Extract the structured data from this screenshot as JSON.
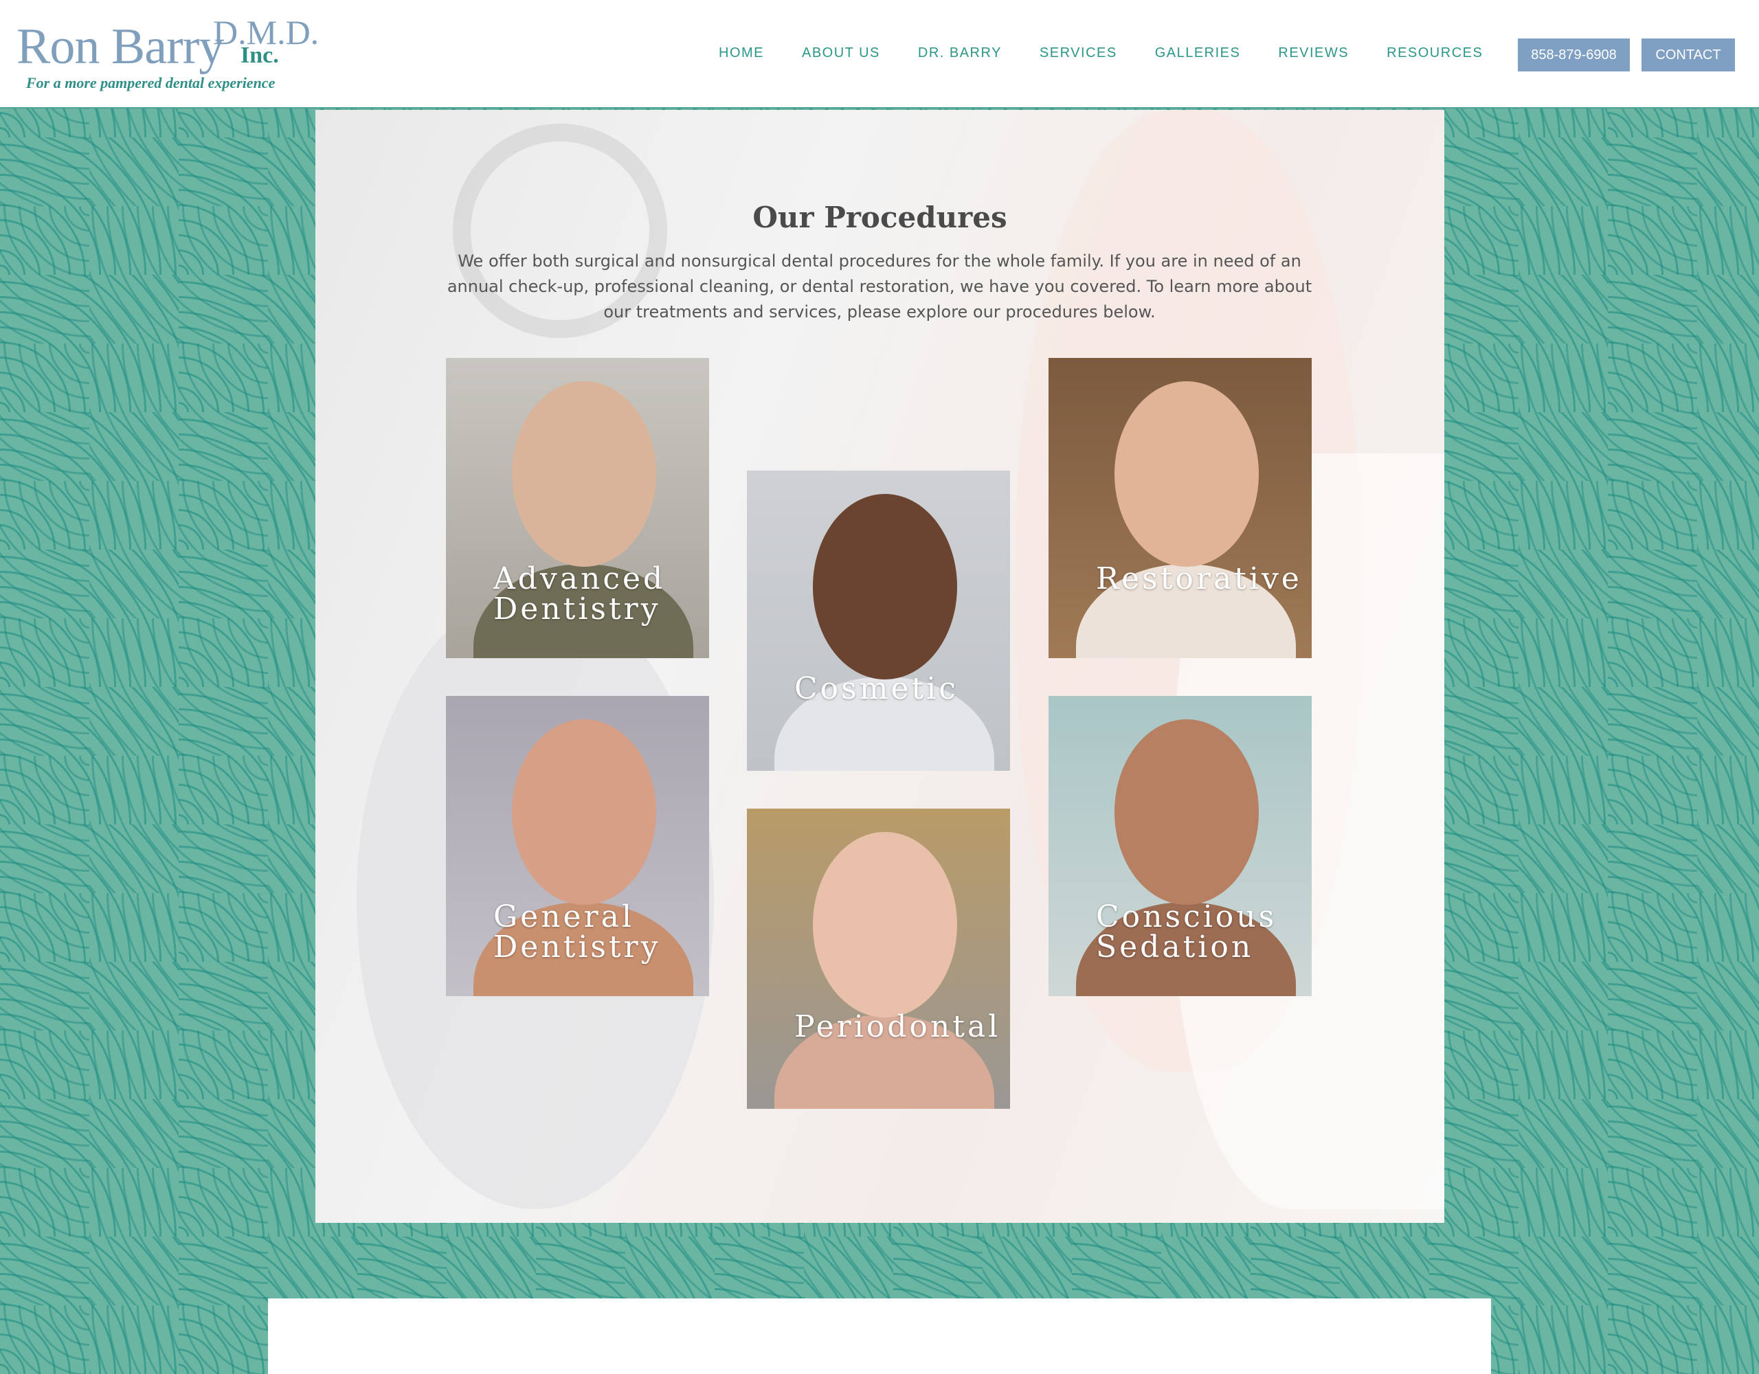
{
  "header": {
    "logo": {
      "name": "Ron Barry",
      "suffix": "D.M.D.",
      "inc": "Inc.",
      "tagline": "For a more pampered dental experience"
    },
    "nav": [
      "HOME",
      "ABOUT US",
      "DR. BARRY",
      "SERVICES",
      "GALLERIES",
      "REVIEWS",
      "RESOURCES"
    ],
    "phone_button": "858-879-6908",
    "contact_button": "CONTACT"
  },
  "main": {
    "title": "Our Procedures",
    "intro": "We offer both surgical and nonsurgical dental procedures for the whole family. If you are in need of an annual check-up, professional cleaning, or dental restoration, we have you covered. To learn more about our treatments and services, please explore our procedures below.",
    "procedures": [
      {
        "label": "Advanced Dentistry"
      },
      {
        "label": "Cosmetic"
      },
      {
        "label": "Restorative"
      },
      {
        "label": "General Dentistry"
      },
      {
        "label": "Periodontal"
      },
      {
        "label": "Conscious Sedation"
      }
    ]
  },
  "colors": {
    "teal_accent": "#2c9688",
    "button_blue": "#7f9fc3",
    "logo_blue": "#7f9fbd",
    "pattern_bg": "#6bb5a3"
  }
}
